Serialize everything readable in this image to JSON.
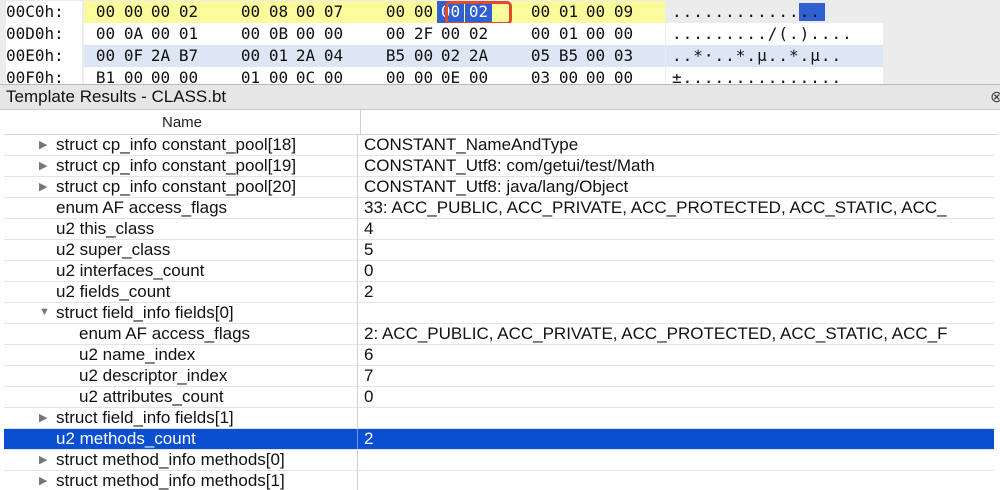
{
  "hex": {
    "rows": [
      {
        "addr": "00C0h:",
        "bytes": [
          "00",
          "00",
          "00",
          "02",
          "00",
          "08",
          "00",
          "07",
          "00",
          "00",
          "00",
          "02",
          "00",
          "01",
          "00",
          "09"
        ],
        "ascii": ".............."
      },
      {
        "addr": "00D0h:",
        "bytes": [
          "00",
          "0A",
          "00",
          "01",
          "00",
          "0B",
          "00",
          "00",
          "00",
          "2F",
          "00",
          "02",
          "00",
          "01",
          "00",
          "00"
        ],
        "ascii": "........./(.)...."
      },
      {
        "addr": "00E0h:",
        "bytes": [
          "00",
          "0F",
          "2A",
          "B7",
          "00",
          "01",
          "2A",
          "04",
          "B5",
          "00",
          "02",
          "2A",
          "05",
          "B5",
          "00",
          "03"
        ],
        "ascii": "..*·..*.µ..*.µ.."
      },
      {
        "addr": "00F0h:",
        "bytes": [
          "B1",
          "00",
          "00",
          "00",
          "01",
          "00",
          "0C",
          "00",
          "00",
          "00",
          "0E",
          "00",
          "03",
          "00",
          "00",
          "00"
        ],
        "ascii": "±..............."
      }
    ]
  },
  "template": {
    "title": "Template Results - CLASS.bt",
    "close_glyph": "⊗",
    "col_name": "Name",
    "rows": [
      {
        "label": "struct cp_info constant_pool[18]",
        "value": "CONSTANT_NameAndType",
        "expander": "collapsed"
      },
      {
        "label": "struct cp_info constant_pool[19]",
        "value": "CONSTANT_Utf8: com/getui/test/Math",
        "expander": "collapsed"
      },
      {
        "label": "struct cp_info constant_pool[20]",
        "value": "CONSTANT_Utf8: java/lang/Object",
        "expander": "collapsed"
      },
      {
        "label": "enum AF access_flags",
        "value": "33: ACC_PUBLIC, ACC_PRIVATE, ACC_PROTECTED, ACC_STATIC, ACC_",
        "expander": "none"
      },
      {
        "label": "u2 this_class",
        "value": "4",
        "expander": "none"
      },
      {
        "label": "u2 super_class",
        "value": "5",
        "expander": "none"
      },
      {
        "label": "u2 interfaces_count",
        "value": "0",
        "expander": "none"
      },
      {
        "label": "u2 fields_count",
        "value": "2",
        "expander": "none"
      },
      {
        "label": "struct field_info fields[0]",
        "value": "",
        "expander": "expanded"
      },
      {
        "label": "enum AF access_flags",
        "value": "2: ACC_PUBLIC, ACC_PRIVATE, ACC_PROTECTED, ACC_STATIC, ACC_F",
        "expander": "child"
      },
      {
        "label": "u2 name_index",
        "value": "6",
        "expander": "child"
      },
      {
        "label": "u2 descriptor_index",
        "value": "7",
        "expander": "child"
      },
      {
        "label": "u2 attributes_count",
        "value": "0",
        "expander": "child"
      },
      {
        "label": "struct field_info fields[1]",
        "value": "",
        "expander": "collapsed"
      },
      {
        "label": "u2 methods_count",
        "value": "2",
        "expander": "none",
        "selected": true
      },
      {
        "label": "struct method_info methods[0]",
        "value": "",
        "expander": "collapsed"
      },
      {
        "label": "struct method_info methods[1]",
        "value": "",
        "expander": "collapsed"
      }
    ]
  },
  "colors": {
    "selection": "#0a4fd2",
    "hex_highlight_yellow": "#fbfb9c",
    "hex_highlight_blue": "#dde6f5",
    "focus_box": "#e24a30"
  }
}
